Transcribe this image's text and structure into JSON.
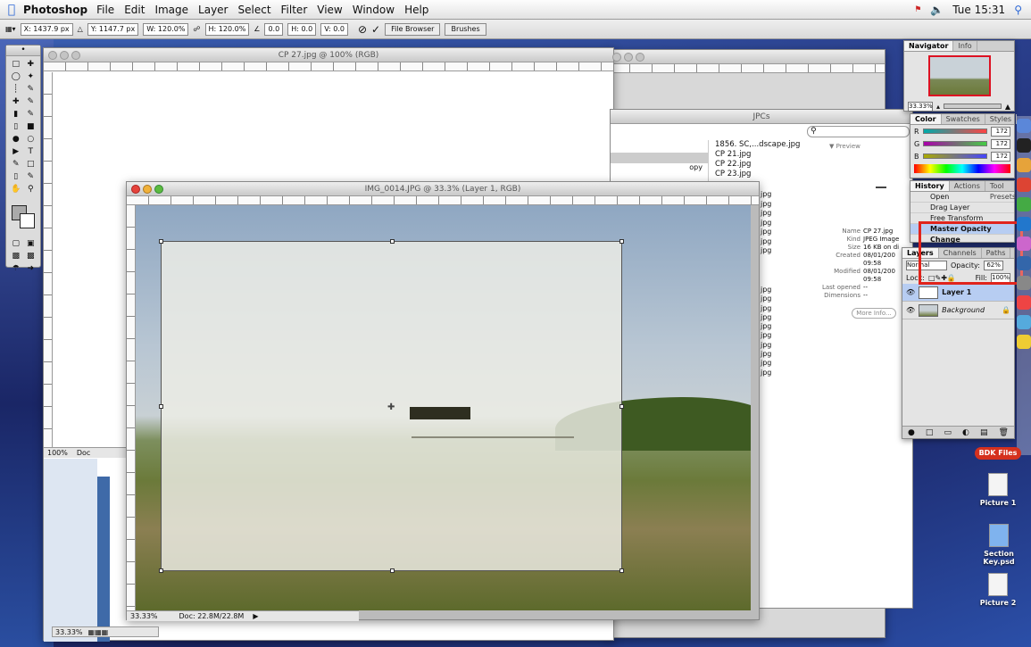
{
  "menubar": {
    "app": "Photoshop",
    "items": [
      "File",
      "Edit",
      "Image",
      "Layer",
      "Select",
      "Filter",
      "View",
      "Window",
      "Help"
    ],
    "clock": "Tue 15:31"
  },
  "options": {
    "x": "X: 1437.9 px",
    "y": "Y: 1147.7 px",
    "w": "W: 120.0%",
    "h": "H: 120.0%",
    "angle": "0.0",
    "hskew": "H: 0.0",
    "vskew": "V: 0.0",
    "file_browser": "File Browser",
    "brushes": "Brushes"
  },
  "bgwin": {
    "title": "CP 27.jpg @ 100% (RGB)",
    "zoom": "100%",
    "doc": "Doc"
  },
  "browser": {
    "folder": "JPCs",
    "files": [
      "1856. SC,...dscape.jpg",
      "CP 21.jpg",
      "CP 22.jpg",
      "CP 23.jpg"
    ],
    "partial": [
      "jpg",
      "jpg",
      "jpg",
      "jpg",
      "jpg",
      "jpg",
      "jpg"
    ],
    "partial2": [
      "jpg",
      "jpg",
      "jpg",
      "jpg",
      "jpg",
      "jpg",
      "jpg",
      "jpg",
      "jpg",
      "jpg"
    ],
    "copy": "opy",
    "preview": "▼ Preview",
    "meta": [
      {
        "k": "Name",
        "v": "CP 27.jpg"
      },
      {
        "k": "Kind",
        "v": "JPEG Image"
      },
      {
        "k": "Size",
        "v": "16 KB on di"
      },
      {
        "k": "Created",
        "v": "08/01/200"
      },
      {
        "k": "",
        "v": "09:58"
      },
      {
        "k": "Modified",
        "v": "08/01/200"
      },
      {
        "k": "",
        "v": "09:58"
      },
      {
        "k": "Last opened",
        "v": "--"
      },
      {
        "k": "Dimensions",
        "v": "--"
      }
    ],
    "more": "More Info..."
  },
  "main": {
    "title": "IMG_0014.JPG @ 33.3% (Layer 1, RGB)",
    "zoom": "33.33%",
    "doc": "Doc: 22.8M/22.8M"
  },
  "navigator": {
    "tabs": [
      "Navigator",
      "Info"
    ],
    "zoom": "33.33%"
  },
  "color": {
    "tabs": [
      "Color",
      "Swatches",
      "Styles"
    ],
    "rows": [
      {
        "l": "R",
        "v": "172"
      },
      {
        "l": "G",
        "v": "172"
      },
      {
        "l": "B",
        "v": "172"
      }
    ]
  },
  "history": {
    "tabs": [
      "History",
      "Actions",
      "Tool Presets"
    ],
    "items": [
      "Open",
      "Drag Layer",
      "Free Transform",
      "Master Opacity Change"
    ]
  },
  "layers": {
    "tabs": [
      "Layers",
      "Channels",
      "Paths"
    ],
    "mode": "Normal",
    "opacity_label": "Opacity:",
    "opacity": "62%",
    "lock": "Lock:",
    "fill_label": "Fill:",
    "fill": "100%",
    "items": [
      "Layer 1",
      "Background"
    ]
  },
  "desktop": {
    "badge": "BDK Files",
    "icons": [
      "Picture 1",
      "Section Key.psd",
      "Picture 2"
    ]
  },
  "bl": {
    "zoom": "33.33%"
  },
  "colors": {
    "highlight": "#e0241c",
    "selection": "#b7cdf2"
  }
}
